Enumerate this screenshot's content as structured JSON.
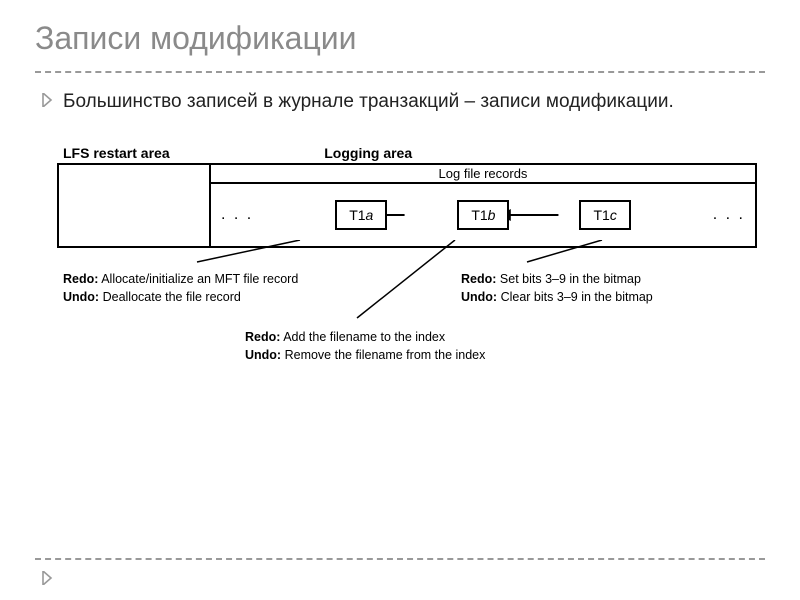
{
  "title": "Записи модификации",
  "bullet": "Большинство записей в журнале транзакций – записи модификации.",
  "diagram": {
    "labels": {
      "lfs": "LFS restart area",
      "logging": "Logging area",
      "header": "Log file records"
    },
    "dots": ". . .",
    "records": [
      "T1a",
      "T1b",
      "T1c"
    ],
    "caps": {
      "c1": {
        "redo": "Redo: Allocate/initialize an MFT file record",
        "undo": "Undo: Deallocate the file record"
      },
      "c2": {
        "redo": "Redo: Set bits 3–9 in the bitmap",
        "undo": "Undo: Clear bits 3–9 in the bitmap"
      },
      "c3": {
        "redo": "Redo: Add the filename to the index",
        "undo": "Undo: Remove the filename from the index"
      }
    }
  },
  "chart_data": {
    "type": "diagram",
    "description": "Log file structure with LFS restart area and logging area containing records T1a←T1b←T1c",
    "records": [
      {
        "id": "T1a",
        "redo": "Allocate/initialize an MFT file record",
        "undo": "Deallocate the file record"
      },
      {
        "id": "T1b",
        "redo": "Add the filename to the index",
        "undo": "Remove the filename from the index"
      },
      {
        "id": "T1c",
        "redo": "Set bits 3–9 in the bitmap",
        "undo": "Clear bits 3–9 in the bitmap"
      }
    ],
    "linked_list_direction": "backward"
  }
}
